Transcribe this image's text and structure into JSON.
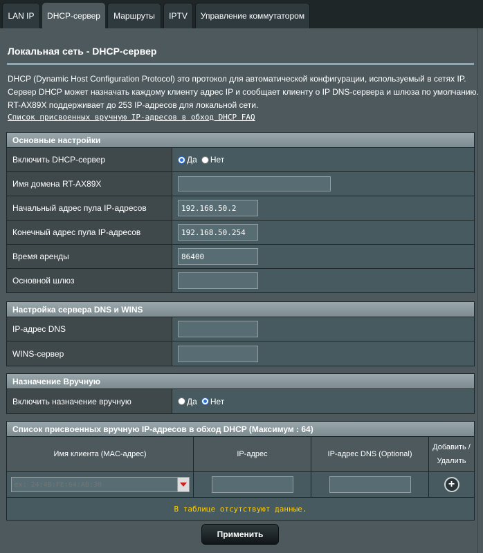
{
  "tabs": [
    {
      "label": "LAN IP"
    },
    {
      "label": "DHCP-сервер",
      "active": true
    },
    {
      "label": "Маршруты"
    },
    {
      "label": "IPTV"
    },
    {
      "label": "Управление коммутатором"
    }
  ],
  "page": {
    "title": "Локальная сеть - DHCP-сервер",
    "desc_line1": "DHCP (Dynamic Host Configuration Protocol) это протокол для автоматической конфигурации, используемый в сетях IP.",
    "desc_line2": "Сервер DHCP может назначать каждому клиенту адрес IP и сообщает клиенту о IP DNS-сервера и шлюза по умолчанию.",
    "desc_line3": "RT-AX89X поддерживает до 253 IP-адресов для локальной сети.",
    "faq_link": "Список присвоенных вручную IP-адресов в обход DHCP FAQ"
  },
  "basic": {
    "header": "Основные настройки",
    "enable_label": "Включить DHCP-сервер",
    "yes": "Да",
    "no": "Нет",
    "enable_selected": "yes",
    "domain_label": "Имя домена RT-AX89X",
    "domain_value": "",
    "start_label": "Начальный адрес пула IP-адресов",
    "start_value": "192.168.50.2",
    "end_label": "Конечный адрес пула IP-адресов",
    "end_value": "192.168.50.254",
    "lease_label": "Время аренды",
    "lease_value": "86400",
    "gateway_label": "Основной шлюз",
    "gateway_value": ""
  },
  "dns": {
    "header": "Настройка сервера DNS и WINS",
    "dns_label": "IP-адрес DNS",
    "dns_value": "",
    "wins_label": "WINS-сервер",
    "wins_value": ""
  },
  "manual": {
    "header": "Назначение Вручную",
    "enable_label": "Включить назначение вручную",
    "yes": "Да",
    "no": "Нет",
    "enable_selected": "no"
  },
  "list": {
    "header": "Список присвоенных вручную IP-адресов в обход DHCP (Максимум : 64)",
    "col_client": "Имя клиента (MAC-адрес)",
    "col_ip": "IP-адрес",
    "col_dns": "IP-адрес DNS (Optional)",
    "col_add_line1": "Добавить /",
    "col_add_line2": "Удалить",
    "client_placeholder": "ex: 24:4B:FE:64:AB:30",
    "add_symbol": "+",
    "empty_text": "В таблице отсутствуют данные."
  },
  "apply_label": "Применить"
}
